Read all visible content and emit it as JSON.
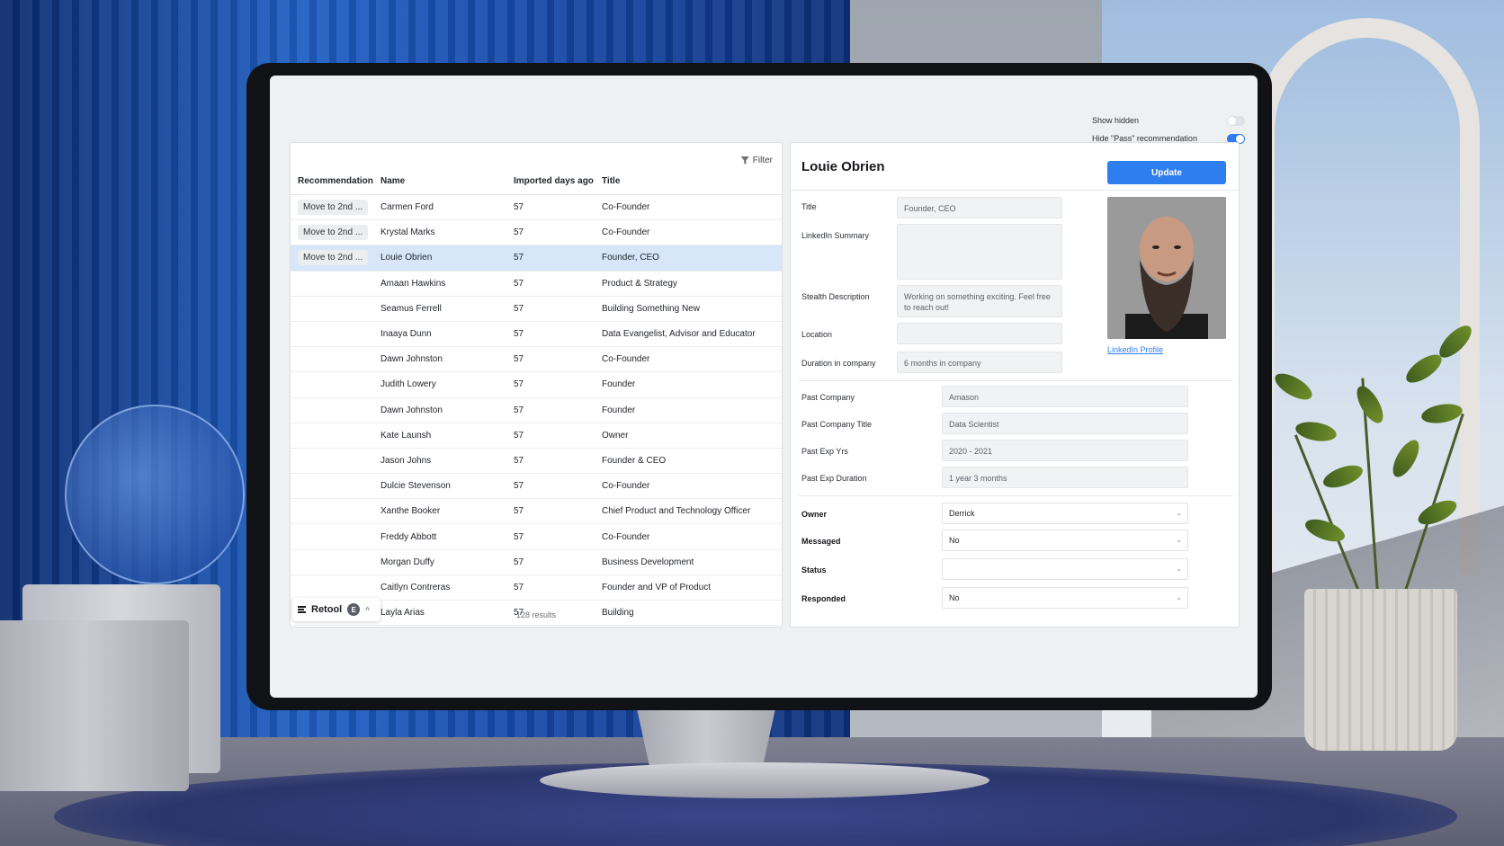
{
  "controls": {
    "show_hidden_label": "Show hidden",
    "show_hidden_on": false,
    "hide_pass_label": "Hide \"Pass\" recommendation",
    "hide_pass_on": true
  },
  "table": {
    "filter_label": "Filter",
    "headers": {
      "recommendation": "Recommendation",
      "name": "Name",
      "days": "Imported days ago",
      "title": "Title"
    },
    "rows": [
      {
        "rec": "Move to 2nd ...",
        "name": "Carmen Ford",
        "days": "57",
        "title": "Co-Founder"
      },
      {
        "rec": "Move to 2nd ...",
        "name": "Krystal Marks",
        "days": "57",
        "title": "Co-Founder"
      },
      {
        "rec": "Move to 2nd ...",
        "name": "Louie Obrien",
        "days": "57",
        "title": "Founder, CEO"
      },
      {
        "rec": "",
        "name": "Amaan Hawkins",
        "days": "57",
        "title": "Product & Strategy"
      },
      {
        "rec": "",
        "name": "Seamus Ferrell",
        "days": "57",
        "title": "Building Something New"
      },
      {
        "rec": "",
        "name": "Inaaya Dunn",
        "days": "57",
        "title": "Data Evangelist, Advisor and Educator"
      },
      {
        "rec": "",
        "name": "Dawn Johnston",
        "days": "57",
        "title": "Co-Founder"
      },
      {
        "rec": "",
        "name": "Judith Lowery",
        "days": "57",
        "title": "Founder"
      },
      {
        "rec": "",
        "name": "Dawn Johnston",
        "days": "57",
        "title": "Founder"
      },
      {
        "rec": "",
        "name": "Kate Launsh",
        "days": "57",
        "title": "Owner"
      },
      {
        "rec": "",
        "name": "Jason Johns",
        "days": "57",
        "title": "Founder & CEO"
      },
      {
        "rec": "",
        "name": "Dulcie Stevenson",
        "days": "57",
        "title": "Co-Founder"
      },
      {
        "rec": "",
        "name": "Xanthe Booker",
        "days": "57",
        "title": "Chief Product and Technology Officer"
      },
      {
        "rec": "",
        "name": "Freddy Abbott",
        "days": "57",
        "title": "Co-Founder"
      },
      {
        "rec": "",
        "name": "Morgan Duffy",
        "days": "57",
        "title": "Business Development"
      },
      {
        "rec": "",
        "name": "Caitlyn Contreras",
        "days": "57",
        "title": "Founder and VP of Product"
      },
      {
        "rec": "",
        "name": "Layla Arias",
        "days": "57",
        "title": "Building"
      }
    ],
    "selected_row": 2,
    "results_text": "128 results"
  },
  "retool": {
    "label": "Retool",
    "env_letter": "E",
    "caret": "^"
  },
  "detail": {
    "name": "Louie Obrien",
    "update_label": "Update",
    "labels": {
      "title": "Title",
      "linkedin_summary": "LinkedIn Summary",
      "stealth_description": "Stealth Description",
      "location": "Location",
      "duration": "Duration in company",
      "past_company": "Past Company",
      "past_company_title": "Past Company Title",
      "past_exp_yrs": "Past Exp Yrs",
      "past_exp_duration": "Past Exp Duration",
      "owner": "Owner",
      "messaged": "Messaged",
      "status": "Status",
      "responded": "Responded"
    },
    "values": {
      "title": "Founder, CEO",
      "linkedin_summary": "",
      "stealth_description": "Working on something exciting. Feel free to reach out!",
      "location": "",
      "duration": "6 months in company",
      "past_company": "Amason",
      "past_company_title": "Data Scientist",
      "past_exp_yrs": "2020 - 2021",
      "past_exp_duration": "1 year 3 months",
      "owner": "Derrick",
      "messaged": "No",
      "status": "",
      "responded": "No"
    },
    "linkedin_profile_label": "LinkedIn Profile"
  },
  "colors": {
    "accent": "#2f7ef0",
    "selected_row": "#d7e6f8"
  }
}
